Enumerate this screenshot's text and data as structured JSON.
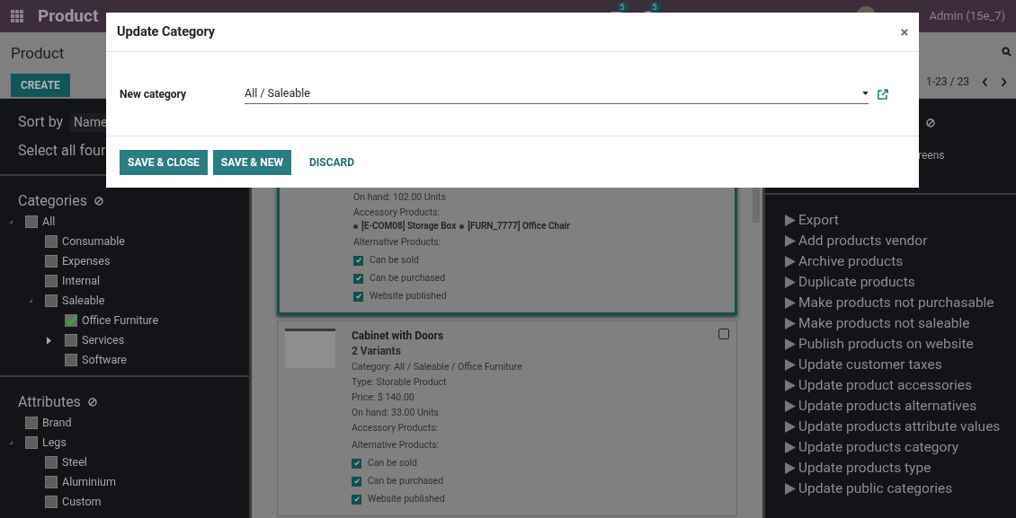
{
  "navbar": {
    "app_title": "Product",
    "chat_count": "5",
    "activity_count": "5",
    "user": "Admin (15e_7)"
  },
  "control_panel": {
    "title": "Product",
    "create": "CREATE",
    "pager": "1-23 / 23"
  },
  "left_panel": {
    "sort_label": "Sort by",
    "sort_value": "Name",
    "select_all": "Select all four",
    "sections": [
      {
        "title": "Categories",
        "items": [
          {
            "label": "All",
            "checked": false,
            "expanded": true,
            "children": [
              {
                "label": "Consumable",
                "checked": false
              },
              {
                "label": "Expenses",
                "checked": false
              },
              {
                "label": "Internal",
                "checked": false
              },
              {
                "label": "Saleable",
                "checked": false,
                "expanded": true,
                "children": [
                  {
                    "label": "Office Furniture",
                    "checked": true
                  },
                  {
                    "label": "Services",
                    "checked": false,
                    "expanded": false
                  },
                  {
                    "label": "Software",
                    "checked": false
                  }
                ]
              }
            ]
          }
        ]
      },
      {
        "title": "Attributes",
        "items": [
          {
            "label": "Brand",
            "checked": false
          },
          {
            "label": "Legs",
            "checked": false,
            "expanded": true,
            "children": [
              {
                "label": "Steel",
                "checked": false
              },
              {
                "label": "Aluminium",
                "checked": false
              },
              {
                "label": "Custom",
                "checked": false
              }
            ]
          }
        ]
      }
    ]
  },
  "cards": [
    {
      "selected": true,
      "lines": [
        "On hand: 102.00 Units",
        "Accessory Products:"
      ],
      "accessories": [
        "[E-COM08] Storage Box",
        "[FURN_7777] Office Chair"
      ],
      "alternatives_label": "Alternative Products:",
      "flags": [
        {
          "label": "Can be sold",
          "checked": true
        },
        {
          "label": "Can be purchased",
          "checked": true
        },
        {
          "label": "Website published",
          "checked": true
        }
      ]
    },
    {
      "selected": false,
      "title": "Cabinet with Doors",
      "variants": "2 Variants",
      "lines": [
        "Category: All / Saleable / Office Furniture",
        "Type: Storable Product",
        "Price: $ 140.00",
        "On hand: 33.00 Units",
        "Accessory Products:"
      ],
      "alternatives_label": "Alternative Products:",
      "flags": [
        {
          "label": "Can be sold",
          "checked": true
        },
        {
          "label": "Can be purchased",
          "checked": true
        },
        {
          "label": "Website published",
          "checked": true
        }
      ],
      "checked": false
    }
  ],
  "right_panel": {
    "snippet": "reens",
    "actions": [
      "Export",
      "Add products vendor",
      "Archive products",
      "Duplicate products",
      "Make products not purchasable",
      "Make products not saleable",
      "Publish products on website",
      "Update customer taxes",
      "Update product accessories",
      "Update products alternatives",
      "Update products attribute values",
      "Update products category",
      "Update products type",
      "Update public categories"
    ]
  },
  "dialog": {
    "title": "Update Category",
    "field_label": "New category",
    "field_value": "All / Saleable",
    "buttons": [
      {
        "label": "SAVE & CLOSE",
        "kind": "primary"
      },
      {
        "label": "SAVE & NEW",
        "kind": "primary"
      },
      {
        "label": "DISCARD",
        "kind": "link"
      }
    ]
  }
}
